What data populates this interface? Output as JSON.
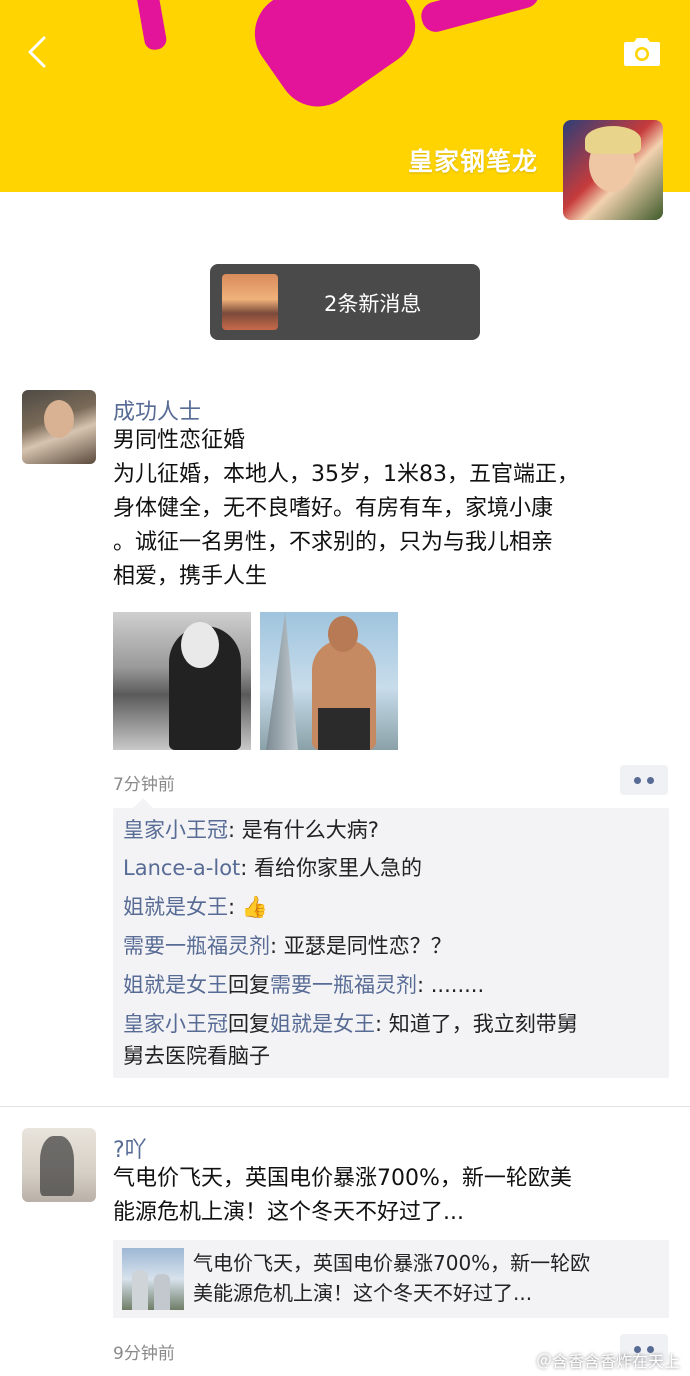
{
  "header": {
    "profile_name": "皇家钢笔龙",
    "back_icon": "chevron-left-icon",
    "camera_icon": "camera-icon"
  },
  "new_messages": {
    "label": "2条新消息"
  },
  "posts": [
    {
      "nickname": "成功人士",
      "lines": [
        "男同性恋征婚",
        "为儿征婚，本地人，35岁，1米83，五官端正，",
        "身体健全，无不良嗜好。有房有车，家境小康",
        "。诚征一名男性，不求别的，只为与我儿相亲",
        "相爱，携手人生"
      ],
      "time": "7分钟前",
      "comments": [
        {
          "user": "皇家小王冠",
          "text": ": 是有什么大病?"
        },
        {
          "user": "Lance-a-lot",
          "text": ": 看给你家里人急的"
        },
        {
          "user": "姐就是女王",
          "text": ": 👍"
        },
        {
          "user": "需要一瓶福灵剂",
          "text": ": 亚瑟是同性恋？？"
        },
        {
          "user": "姐就是女王",
          "reply_word": "回复",
          "reply_to": "需要一瓶福灵剂",
          "text": ": ........"
        },
        {
          "user": "皇家小王冠",
          "reply_word": "回复",
          "reply_to": "姐就是女王",
          "text": ": 知道了，我立刻带舅",
          "text2": "舅去医院看脑子"
        }
      ]
    },
    {
      "nickname": "?吖",
      "lines": [
        "气电价飞天，英国电价暴涨700%，新一轮欧美",
        "能源危机上演！这个冬天不好过了..."
      ],
      "link": {
        "line1": "气电价飞天，英国电价暴涨700%，新一轮欧",
        "line2": "美能源危机上演！这个冬天不好过了..."
      },
      "time": "9分钟前"
    }
  ],
  "watermark": "＠含香含香炸在天上",
  "colors": {
    "cover": "#ffd400",
    "link_blue": "#576b95",
    "comment_bg": "#f3f3f5"
  }
}
